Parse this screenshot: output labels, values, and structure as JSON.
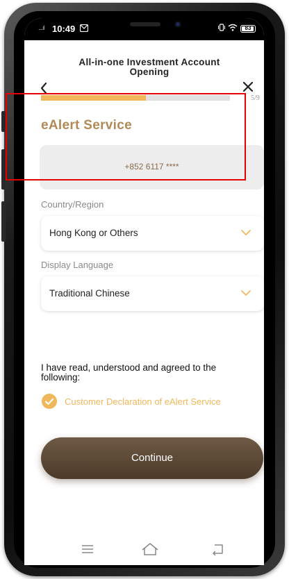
{
  "status_bar": {
    "time": "10:49",
    "signal_dots": "....ıl",
    "battery": "83"
  },
  "header": {
    "back_symbol": "<",
    "title": "All-in-one Investment Account Opening",
    "close_symbol": "✕"
  },
  "progress": {
    "text": "5/9",
    "fraction": 0.555
  },
  "ealert": {
    "title": "eAlert Service",
    "phone_value": "+852 6117 ****"
  },
  "country_region": {
    "label": "Country/Region",
    "value": "Hong Kong or Others"
  },
  "display_language": {
    "label": "Display Language",
    "value": "Traditional Chinese"
  },
  "agreement": {
    "text": "I have read, understood and agreed to the following:",
    "declaration_link": "Customer Declaration of eAlert Service"
  },
  "actions": {
    "continue_label": "Continue"
  },
  "colors": {
    "accent_gold": "#f0b85a",
    "title_gold": "#b08a57",
    "button_brown": "#5b4733",
    "highlight_red": "#e60000"
  },
  "icons": [
    "chevron-left-icon",
    "close-icon",
    "chevron-down-icon",
    "check-circle-icon",
    "menu-icon",
    "home-icon",
    "back-icon"
  ]
}
